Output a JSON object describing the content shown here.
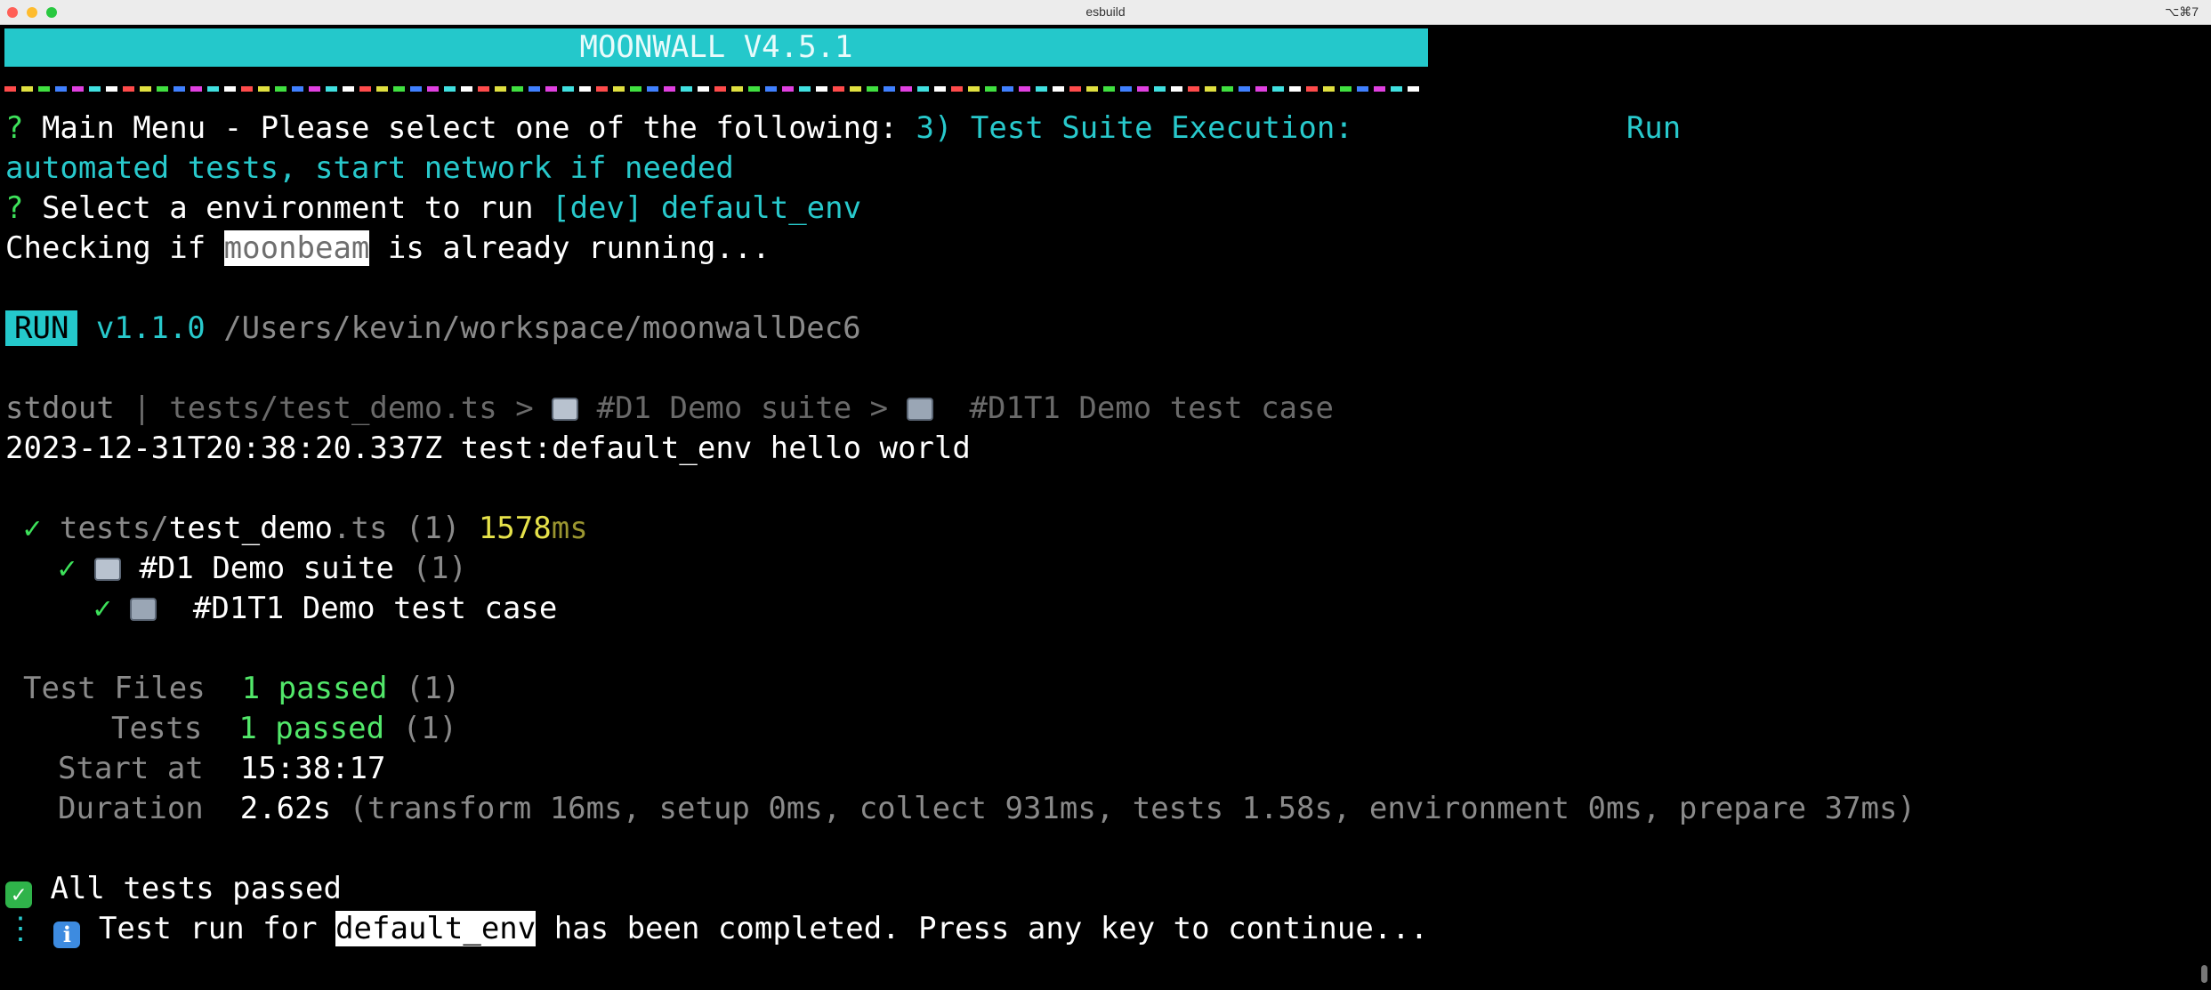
{
  "window": {
    "title": "esbuild",
    "shortcut": "⌥⌘7"
  },
  "banner": {
    "text": "MOONWALL  V4.5.1"
  },
  "separator_colors": [
    "#ff4b4b",
    "#e0e040",
    "#40e040",
    "#4080ff",
    "#e040e0",
    "#40e0e0",
    "#ffffff"
  ],
  "menu": {
    "q1_mark": "?",
    "q1_text": " Main Menu - Please select one of the following:",
    "q1_answer": " 3) Test Suite Execution:               Run",
    "q1_answer_cont": "automated tests, start network if needed",
    "q2_mark": "?",
    "q2_text": " Select a environment to run",
    "q2_answer": " [dev] default_env"
  },
  "check_line": {
    "prefix": "Checking if ",
    "name": "moonbeam",
    "suffix": " is already running..."
  },
  "run_line": {
    "badge": "RUN",
    "version": " v1.1.0",
    "path": " /Users/kevin/workspace/moonwallDec6"
  },
  "stdout_line": {
    "label": "stdout",
    "sep": " | ",
    "file": "tests/test_demo.ts",
    "arrow1": " > ",
    "suite": " #D1 Demo suite",
    "arrow2": " > ",
    "testcase": "  #D1T1 Demo test case"
  },
  "log_line": {
    "text": "2023-12-31T20:38:20.337Z test:default_env hello world"
  },
  "results": {
    "check": "✓",
    "file_dir": "tests/",
    "file_name": "test_demo",
    "file_ext": ".ts",
    "file_count": " (1)",
    "time_value": "1578",
    "time_unit": "ms",
    "suite_name": " #D1 Demo suite",
    "suite_count": " (1)",
    "case_name": "  #D1T1 Demo test case"
  },
  "summary": {
    "files_label": "Test Files",
    "files_value": "1 passed",
    "files_count": " (1)",
    "tests_label": "Tests",
    "tests_value": "1 passed",
    "tests_count": " (1)",
    "start_label": "Start at",
    "start_value": "15:38:17",
    "duration_label": "Duration",
    "duration_value": "2.62s",
    "duration_detail": " (transform 16ms, setup 0ms, collect 931ms, tests 1.58s, environment 0ms, prepare 37ms)"
  },
  "footer": {
    "all_passed": " All tests passed",
    "info_prefix": "⋮",
    "info_text": " Test run for ",
    "env_name": "default_env",
    "info_suffix": " has been completed. Press any key to continue..."
  }
}
